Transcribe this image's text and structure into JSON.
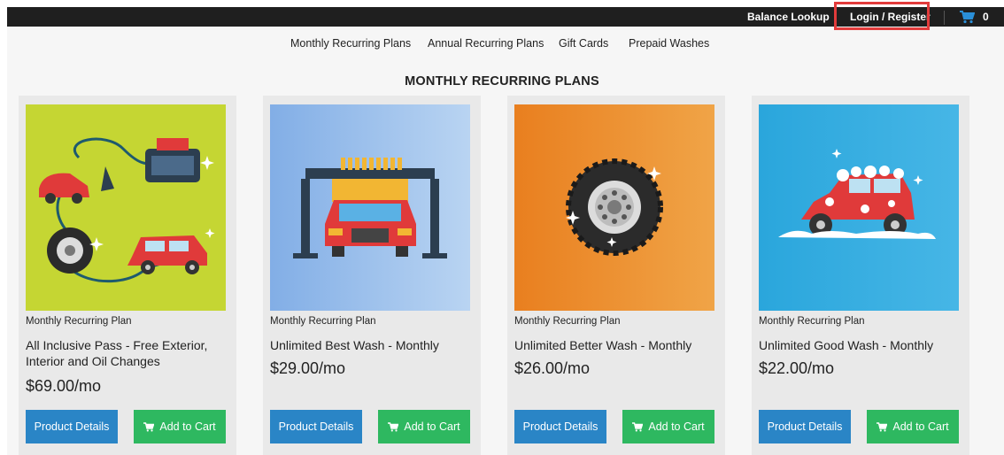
{
  "topbar": {
    "balance_lookup": "Balance Lookup",
    "login_register": "Login / Register",
    "cart_count": "0",
    "cart_icon": "shopping-cart-icon"
  },
  "nav": {
    "items": [
      "Monthly Recurring Plans",
      "Annual Recurring Plans",
      "Gift Cards",
      "Prepaid Washes"
    ]
  },
  "page_title": "MONTHLY RECURRING PLANS",
  "products": [
    {
      "category": "Monthly Recurring Plan",
      "name": "All Inclusive Pass - Free Exterior, Interior and Oil Changes",
      "price": "$69.00/mo",
      "details_label": "Product Details",
      "cart_label": "Add to Cart",
      "image_bg": "#c5d633"
    },
    {
      "category": "Monthly Recurring Plan",
      "name": "Unlimited Best Wash - Monthly",
      "price": "$29.00/mo",
      "details_label": "Product Details",
      "cart_label": "Add to Cart",
      "image_bg": "#8fb6e6"
    },
    {
      "category": "Monthly Recurring Plan",
      "name": "Unlimited Better Wash - Monthly",
      "price": "$26.00/mo",
      "details_label": "Product Details",
      "cart_label": "Add to Cart",
      "image_bg": "#ee8a24"
    },
    {
      "category": "Monthly Recurring Plan",
      "name": "Unlimited Good Wash - Monthly",
      "price": "$22.00/mo",
      "details_label": "Product Details",
      "cart_label": "Add to Cart",
      "image_bg": "#33ade0"
    }
  ],
  "colors": {
    "details_button": "#2a85c6",
    "cart_button": "#2eb860",
    "topbar": "#1f1f1f",
    "highlight": "#e23b3b"
  }
}
